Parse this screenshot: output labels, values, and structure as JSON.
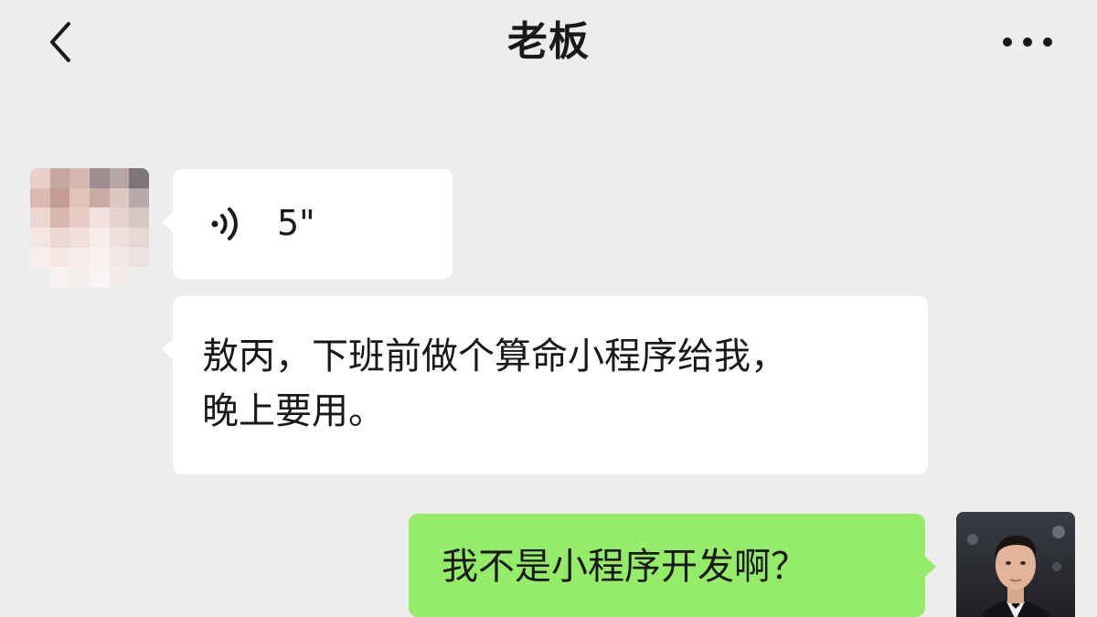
{
  "header": {
    "title": "老板",
    "back_icon": "chevron-left-icon",
    "more_icon": "more-horizontal-icon"
  },
  "messages": [
    {
      "sender": "contact",
      "type": "voice",
      "icon": "voice-wave-icon",
      "duration": "5\""
    },
    {
      "sender": "contact",
      "type": "text",
      "lines": [
        "敖丙，下班前做个算命小程序给我，",
        "晚上要用。"
      ]
    },
    {
      "sender": "self",
      "type": "text",
      "text": "我不是小程序开发啊？"
    }
  ],
  "colors": {
    "background": "#ededed",
    "incoming_bubble": "#ffffff",
    "outgoing_bubble": "#95ec69",
    "text": "#191919"
  }
}
